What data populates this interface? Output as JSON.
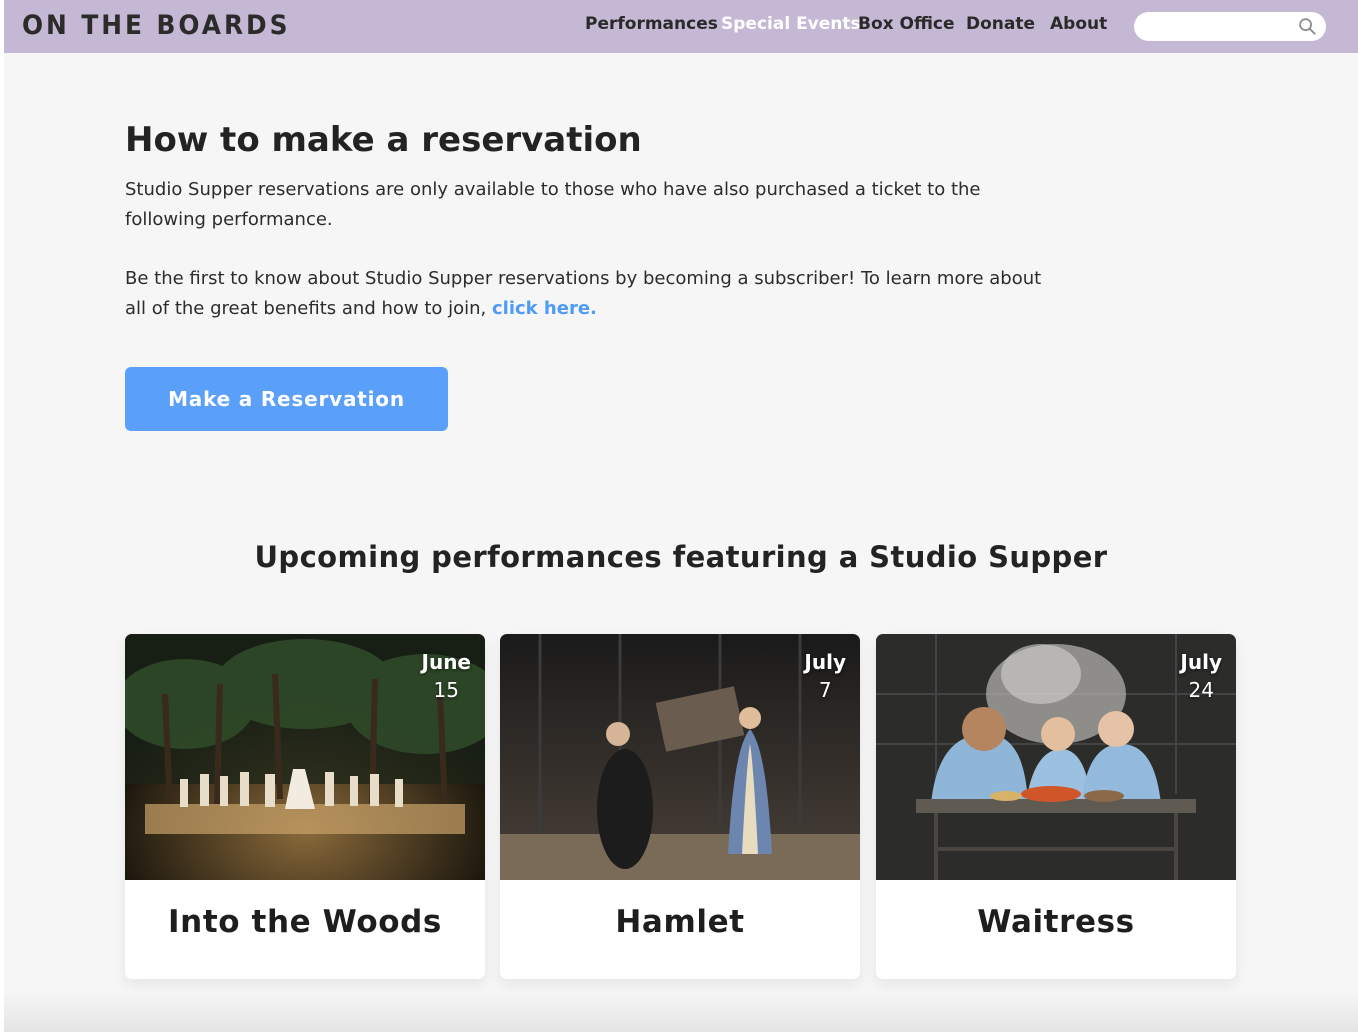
{
  "header": {
    "logo": "ON THE BOARDS",
    "nav": [
      {
        "label": "Performances",
        "active": false
      },
      {
        "label": "Special Events",
        "active": true
      },
      {
        "label": "Box Office",
        "active": false
      },
      {
        "label": "Donate",
        "active": false
      },
      {
        "label": "About",
        "active": false
      }
    ],
    "search": {
      "value": "",
      "placeholder": ""
    }
  },
  "reservation": {
    "heading": "How to make a reservation",
    "paragraph1": "Studio Supper reservations are only available to those who have also purchased a ticket to the following performance.",
    "paragraph2_text": "Be the first to know about Studio Supper reservations by becoming a subscriber! To learn more about all of the great benefits and how to join,",
    "paragraph2_link": "click here.",
    "button_label": "Make a Reservation"
  },
  "upcoming": {
    "heading": "Upcoming performances featuring a Studio Supper",
    "cards": [
      {
        "month": "June",
        "day": "15",
        "title": "Into the Woods"
      },
      {
        "month": "July",
        "day": "7",
        "title": "Hamlet"
      },
      {
        "month": "July",
        "day": "24",
        "title": "Waitress"
      }
    ]
  },
  "colors": {
    "header_bg": "#c5b8d5",
    "accent": "#5aa0fb",
    "link": "#4f9cf6",
    "page_bg": "#f6f6f6"
  }
}
